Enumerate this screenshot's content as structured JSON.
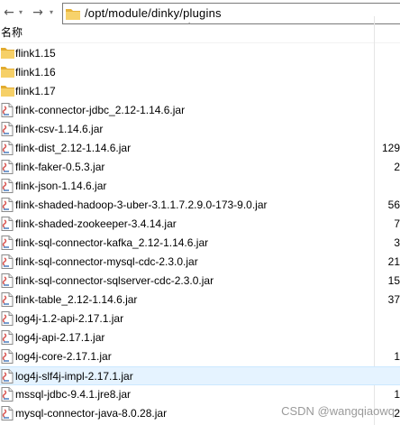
{
  "address": {
    "path": "/opt/module/dinky/plugins"
  },
  "header": {
    "name_label": "名称"
  },
  "rows": [
    {
      "name": "flink1.15",
      "type": "folder",
      "size": ""
    },
    {
      "name": "flink1.16",
      "type": "folder",
      "size": ""
    },
    {
      "name": "flink1.17",
      "type": "folder",
      "size": ""
    },
    {
      "name": "flink-connector-jdbc_2.12-1.14.6.jar",
      "type": "jar",
      "size": ""
    },
    {
      "name": "flink-csv-1.14.6.jar",
      "type": "jar",
      "size": ""
    },
    {
      "name": "flink-dist_2.12-1.14.6.jar",
      "type": "jar",
      "size": "129"
    },
    {
      "name": "flink-faker-0.5.3.jar",
      "type": "jar",
      "size": "2"
    },
    {
      "name": "flink-json-1.14.6.jar",
      "type": "jar",
      "size": ""
    },
    {
      "name": "flink-shaded-hadoop-3-uber-3.1.1.7.2.9.0-173-9.0.jar",
      "type": "jar",
      "size": "56"
    },
    {
      "name": "flink-shaded-zookeeper-3.4.14.jar",
      "type": "jar",
      "size": "7"
    },
    {
      "name": "flink-sql-connector-kafka_2.12-1.14.6.jar",
      "type": "jar",
      "size": "3"
    },
    {
      "name": "flink-sql-connector-mysql-cdc-2.3.0.jar",
      "type": "jar",
      "size": "21"
    },
    {
      "name": "flink-sql-connector-sqlserver-cdc-2.3.0.jar",
      "type": "jar",
      "size": "15"
    },
    {
      "name": "flink-table_2.12-1.14.6.jar",
      "type": "jar",
      "size": "37"
    },
    {
      "name": "log4j-1.2-api-2.17.1.jar",
      "type": "jar",
      "size": ""
    },
    {
      "name": "log4j-api-2.17.1.jar",
      "type": "jar",
      "size": ""
    },
    {
      "name": "log4j-core-2.17.1.jar",
      "type": "jar",
      "size": "1"
    },
    {
      "name": "log4j-slf4j-impl-2.17.1.jar",
      "type": "jar",
      "size": "",
      "selected": true
    },
    {
      "name": "mssql-jdbc-9.4.1.jre8.jar",
      "type": "jar",
      "size": "1"
    },
    {
      "name": "mysql-connector-java-8.0.28.jar",
      "type": "jar",
      "size": "2"
    }
  ],
  "watermark": "CSDN @wangqiaowq",
  "colors": {
    "folder": "#f0c24b",
    "selection": "#e5f3ff",
    "jar_icon": "#4a7dbf"
  }
}
